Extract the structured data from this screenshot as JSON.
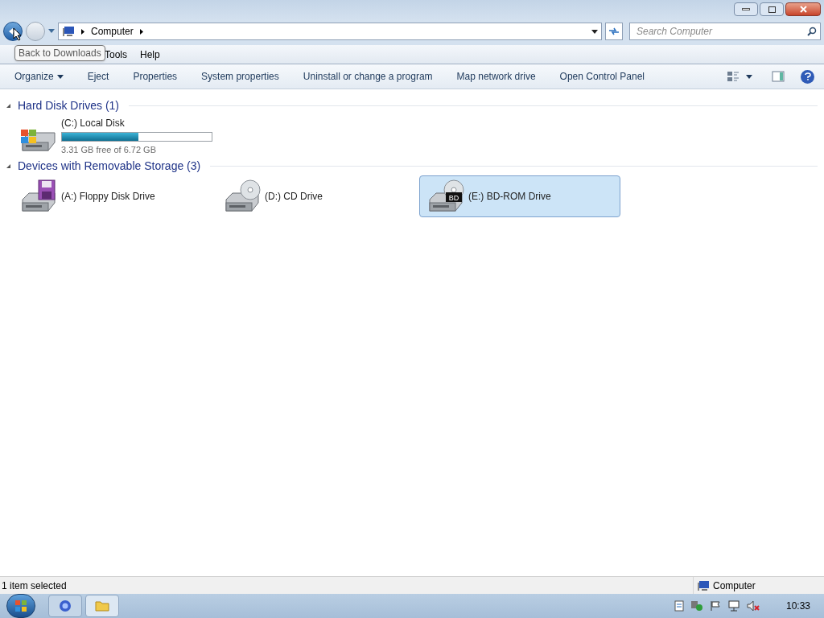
{
  "address_bar": {
    "crumbs": [
      "Computer"
    ]
  },
  "search": {
    "placeholder": "Search Computer"
  },
  "tooltip": "Back to Downloads",
  "menu_bar": [
    "Tools",
    "Help"
  ],
  "command_bar": [
    "Organize",
    "Eject",
    "Properties",
    "System properties",
    "Uninstall or change a program",
    "Map network drive",
    "Open Control Panel"
  ],
  "groups": [
    {
      "title": "Hard Disk Drives (1)",
      "expanded": true,
      "items": [
        {
          "kind": "disk",
          "name": "(C:) Local Disk",
          "level": 0.51,
          "detail": "3.31 GB free of 6.72 GB",
          "selected": false
        }
      ]
    },
    {
      "title": "Devices with Removable Storage (3)",
      "expanded": true,
      "items": [
        {
          "kind": "floppy",
          "name": "(A:) Floppy Disk Drive",
          "selected": false
        },
        {
          "kind": "cd",
          "name": "(D:) CD Drive",
          "selected": false
        },
        {
          "kind": "bd",
          "name": "(E:) BD-ROM Drive",
          "badge": "BD",
          "selected": true
        }
      ]
    }
  ],
  "status_bar": {
    "text": "1 item selected",
    "location": "Computer"
  },
  "taskbar": {
    "time": "10:33"
  }
}
